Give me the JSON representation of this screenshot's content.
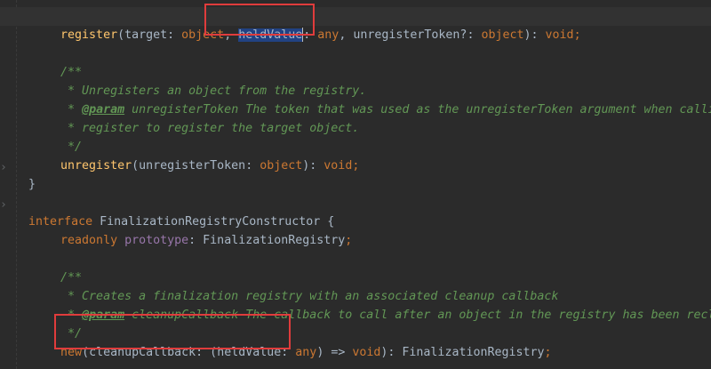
{
  "code": {
    "line1": {
      "fn": "register",
      "open": "(",
      "p1": "target",
      "c1": ": ",
      "t1": "object",
      "comma1": ", ",
      "p2": "heldValue",
      "c2": ": ",
      "t2": "any",
      "comma2": ", ",
      "p3": "unregisterToken?",
      "c3": ": ",
      "t3": "object",
      "close": "): ",
      "ret": "void",
      "semi": ";"
    },
    "comment1": {
      "open": "/**",
      "l1": " * Unregisters an object from the registry.",
      "l2_star": " * ",
      "l2_tag": "@param",
      "l2_text": " unregisterToken The token that was used as the unregisterToken argument when calling",
      "l3": " * register to register the target object.",
      "close": " */"
    },
    "line_unregister": {
      "fn": "unregister",
      "open": "(",
      "p1": "unregisterToken",
      "c1": ": ",
      "t1": "object",
      "close": "): ",
      "ret": "void",
      "semi": ";"
    },
    "brace_close": "}",
    "interface_line": {
      "kw": "interface",
      "name": " FinalizationRegistryConstructor {"
    },
    "readonly_line": {
      "kw": "readonly",
      "space": " ",
      "field": "prototype",
      "colon": ": ",
      "type": "FinalizationRegistry",
      "semi": ";"
    },
    "comment2": {
      "open": "/**",
      "l1": " * Creates a finalization registry with an associated cleanup callback",
      "l2_star": " * ",
      "l2_tag": "@param",
      "l2_text": " cleanupCallback The callback to call after an object in the registry has been reclaime",
      "close": " */"
    },
    "new_line": {
      "kw": "new",
      "open": "(",
      "p1": "cleanupCallback",
      "c1": ": (",
      "p2": "heldValue",
      "c2": ": ",
      "t2": "any",
      "arrow": ") => ",
      "ret1": "void",
      "close": "): ",
      "type": "FinalizationRegistry",
      "semi": ";"
    }
  }
}
